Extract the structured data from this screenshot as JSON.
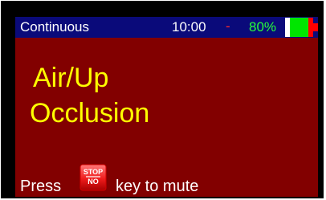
{
  "status_bar": {
    "mode": "Continuous",
    "time": "10:00",
    "separator": "-",
    "battery_percent": "80%",
    "battery_level": 0.8,
    "colors": {
      "background": "#0a0a7a",
      "mode_text": "#ffffff",
      "time_text": "#ffffff",
      "separator": "#ff2a2a",
      "battery_text": "#27ff3a",
      "battery_fill": "#00e600",
      "battery_empty": "#ff0000"
    }
  },
  "alarm": {
    "line1": "Air/Up",
    "line2": "Occlusion",
    "color": "#ffff00",
    "background": "#820000"
  },
  "mute_hint": {
    "prefix": "Press",
    "key_top": "STOP",
    "key_bottom": "NO",
    "suffix": "key to mute"
  },
  "icons": {
    "battery": "battery-icon",
    "stop_key": "stop-no-key-icon"
  }
}
